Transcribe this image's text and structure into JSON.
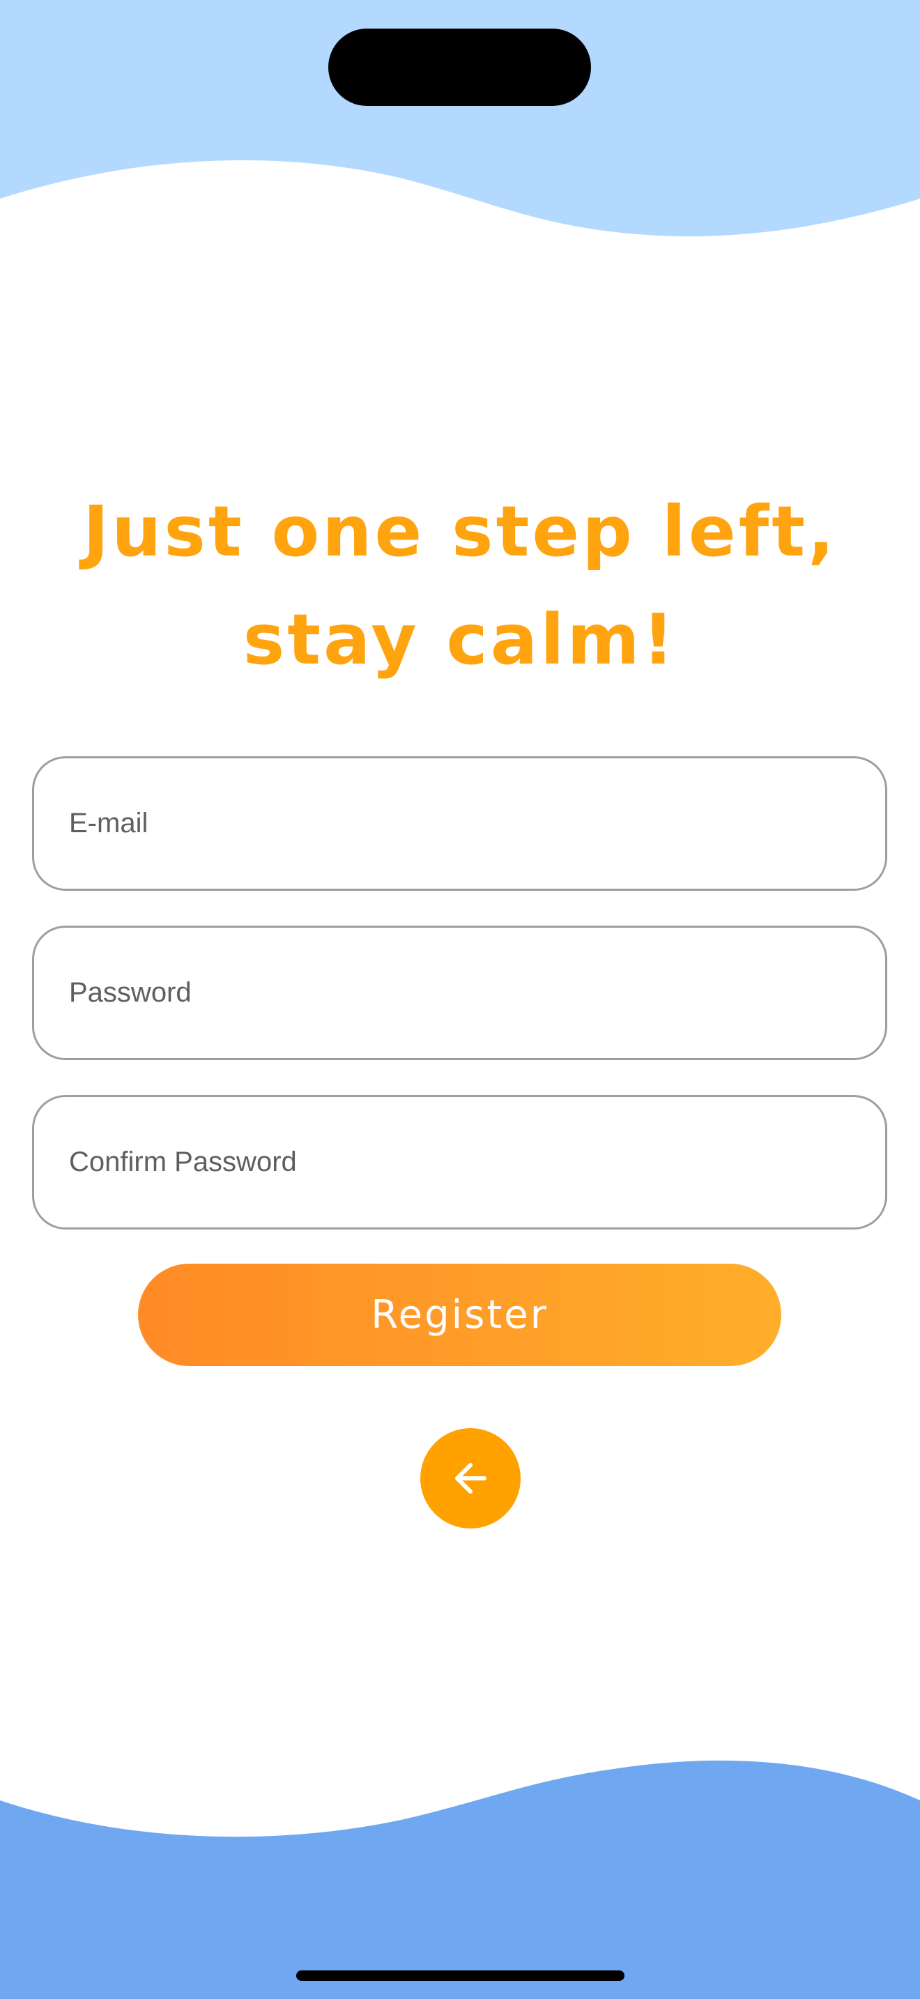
{
  "colors": {
    "top_wave": "#B3D9FF",
    "bottom_wave": "#6FA8F0",
    "accent": "#FFA30F",
    "button_gradient_start": "#FF8A26",
    "button_gradient_end": "#FFAE2A",
    "back_button": "#FFA200"
  },
  "headline": {
    "line1": "Just one step left,",
    "line2": "stay calm!"
  },
  "form": {
    "email": {
      "value": "",
      "placeholder": "E-mail"
    },
    "password": {
      "value": "",
      "placeholder": "Password"
    },
    "confirm_password": {
      "value": "",
      "placeholder": "Confirm Password"
    }
  },
  "register_label": "Register",
  "back_button": {
    "icon": "arrow-left-icon"
  }
}
